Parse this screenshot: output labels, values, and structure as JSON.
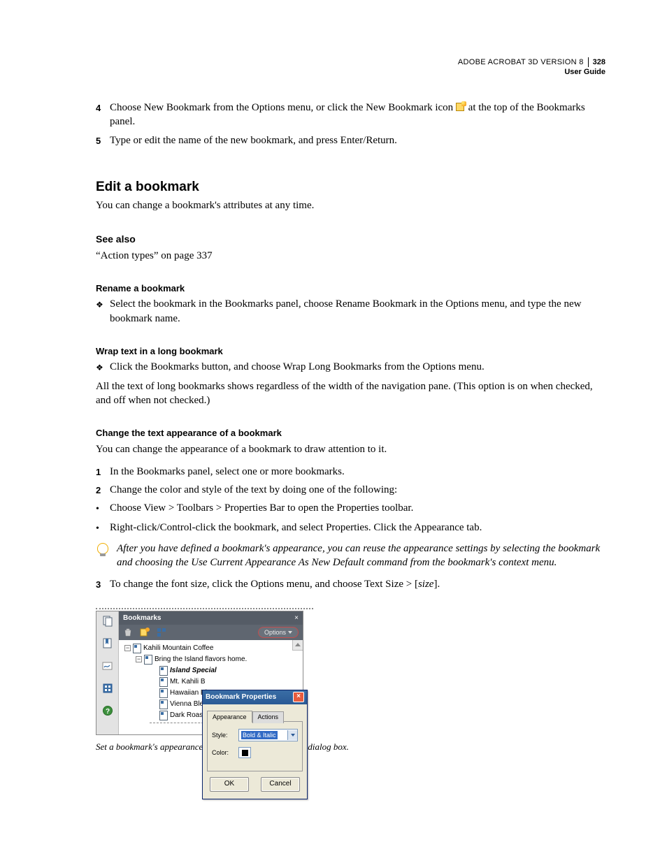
{
  "header": {
    "product": "ADOBE ACROBAT 3D VERSION 8",
    "guide": "User Guide",
    "page_number": "328"
  },
  "intro_steps": {
    "s4_num": "4",
    "s4_a": "Choose New Bookmark from the Options menu, or click the New Bookmark icon ",
    "s4_b": " at the top of the Bookmarks panel.",
    "s5_num": "5",
    "s5": "Type or edit the name of the new bookmark, and press Enter/Return."
  },
  "h2": "Edit a bookmark",
  "h2_para": "You can change a bookmark's attributes at any time.",
  "see_also": {
    "title": "See also",
    "link": "“Action types” on page 337"
  },
  "rename": {
    "title": "Rename a bookmark",
    "body": "Select the bookmark in the Bookmarks panel, choose Rename Bookmark in the Options menu, and type the new bookmark name."
  },
  "wrap": {
    "title": "Wrap text in a long bookmark",
    "b1": "Click the Bookmarks button, and choose Wrap Long Bookmarks from the Options menu.",
    "p1": "All the text of long bookmarks shows regardless of the width of the navigation pane. (This option is on when checked, and off when not checked.)"
  },
  "appear": {
    "title": "Change the text appearance of a bookmark",
    "p1": "You can change the appearance of a bookmark to draw attention to it.",
    "s1_num": "1",
    "s1": "In the Bookmarks panel, select one or more bookmarks.",
    "s2_num": "2",
    "s2": "Change the color and style of the text by doing one of the following:",
    "b1": "Choose View > Toolbars > Properties Bar to open the Properties toolbar.",
    "b2": "Right-click/Control-click the bookmark, and select Properties. Click the Appearance tab.",
    "tip": "After you have defined a bookmark's appearance, you can reuse the appearance settings by selecting the bookmark and choosing the Use Current Appearance As New Default command from the bookmark's context menu.",
    "s3_num": "3",
    "s3_a": "To change the font size, click the Options menu, and choose Text Size > [",
    "s3_size": "size",
    "s3_b": "]."
  },
  "figure": {
    "caption": "Set a bookmark's appearance in the Bookmark Properties dialog box.",
    "panel": {
      "title": "Bookmarks",
      "options": "Options",
      "tree": {
        "t0": "Kahili Mountain Coffee",
        "t1": "Bring the Island flavors home.",
        "t2": "Island Special",
        "t3": "Mt. Kahili B",
        "t4": "Hawaiian Bl",
        "t5": "Vienna Blen",
        "t6": "Dark Roast"
      }
    },
    "dialog": {
      "title": "Bookmark Properties",
      "tab1": "Appearance",
      "tab2": "Actions",
      "style_label": "Style:",
      "style_value": "Bold & Italic",
      "color_label": "Color:",
      "ok": "OK",
      "cancel": "Cancel"
    }
  }
}
